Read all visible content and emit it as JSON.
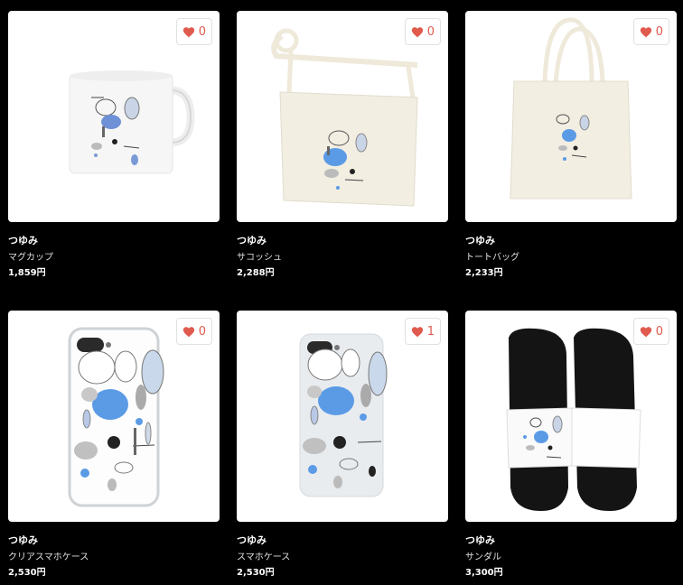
{
  "products": [
    {
      "creator": "つゆみ",
      "name": "マグカップ",
      "price": "1,859円",
      "likes": "0",
      "image": "mug-image"
    },
    {
      "creator": "つゆみ",
      "name": "サコッシュ",
      "price": "2,288円",
      "likes": "0",
      "image": "sacoche-image"
    },
    {
      "creator": "つゆみ",
      "name": "トートバッグ",
      "price": "2,233円",
      "likes": "0",
      "image": "tote-bag-image"
    },
    {
      "creator": "つゆみ",
      "name": "クリアスマホケース",
      "price": "2,530円",
      "likes": "0",
      "image": "clear-phone-case-image"
    },
    {
      "creator": "つゆみ",
      "name": "スマホケース",
      "price": "2,530円",
      "likes": "1",
      "image": "phone-case-image"
    },
    {
      "creator": "つゆみ",
      "name": "サンダル",
      "price": "3,300円",
      "likes": "0",
      "image": "sandals-image"
    }
  ],
  "colors": {
    "heart": "#e05a4e",
    "background": "#000000",
    "card": "#ffffff",
    "pattern_blue": "#5b9be6"
  },
  "icons": {
    "like": "heart-icon"
  }
}
